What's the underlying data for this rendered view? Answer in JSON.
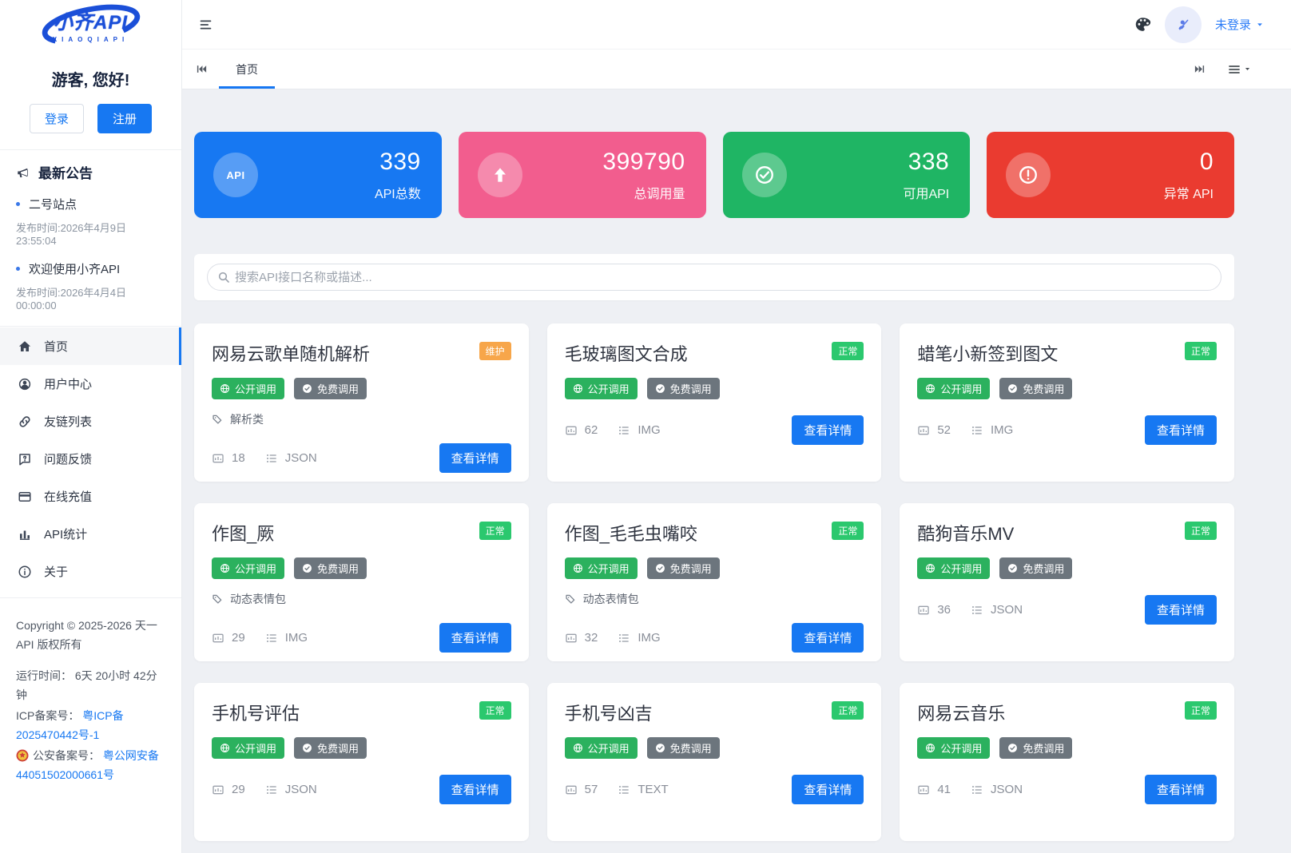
{
  "brand": {
    "name": "小齐API",
    "subtitle": "XIAOQIAPI"
  },
  "header": {
    "login_status": "未登录"
  },
  "tabs": {
    "active": "首页"
  },
  "sidebar": {
    "greeting": "游客, 您好!",
    "login_label": "登录",
    "register_label": "注册",
    "announcements_title": "最新公告",
    "announcements": [
      {
        "title": "二号站点",
        "time": "发布时间:2026年4月9日 23:55:04"
      },
      {
        "title": "欢迎使用小齐API",
        "time": "发布时间:2026年4月4日 00:00:00"
      }
    ],
    "menu": [
      {
        "label": "首页",
        "icon": "home-icon",
        "active": true
      },
      {
        "label": "用户中心",
        "icon": "user-icon"
      },
      {
        "label": "友链列表",
        "icon": "link-icon"
      },
      {
        "label": "问题反馈",
        "icon": "feedback-icon"
      },
      {
        "label": "在线充值",
        "icon": "recharge-icon"
      },
      {
        "label": "API统计",
        "icon": "bar-chart-icon"
      },
      {
        "label": "关于",
        "icon": "info-icon"
      }
    ],
    "footer": {
      "copyright": "Copyright © 2025-2026 天一 API 版权所有",
      "uptime": "运行时间： 6天 20小时 42分钟",
      "icp_label": "ICP备案号：",
      "icp_link": "粤ICP备 2025470442号-1",
      "police_label": "公安备案号：",
      "police_link": "粤公网安备 44051502000661号"
    }
  },
  "stats": [
    {
      "value": "339",
      "label": "API总数",
      "color": "#1778f2",
      "icon": "api-icon",
      "icon_text": "API"
    },
    {
      "value": "399790",
      "label": "总调用量",
      "color": "#f25d8e",
      "icon": "arrow-up-icon"
    },
    {
      "value": "338",
      "label": "可用API",
      "color": "#1fb564",
      "icon": "check-circle-icon"
    },
    {
      "value": "0",
      "label": "异常 API",
      "color": "#ea3b30",
      "icon": "alert-circle-icon"
    }
  ],
  "search": {
    "placeholder": "搜索API接口名称或描述..."
  },
  "badge_labels": {
    "public": "公开调用",
    "free": "免费调用"
  },
  "labels": {
    "detail_button": "查看详情"
  },
  "colors": {
    "accent_blue": "#1778f2",
    "status_normal": "#2bc86e",
    "status_maintenance": "#f7a64a",
    "badge_public": "#2bb15e",
    "badge_free": "#6c757d"
  },
  "api_cards": [
    {
      "title": "网易云歌单随机解析",
      "status": "维护",
      "status_type": "maintenance",
      "tag": "解析类",
      "calls": "18",
      "format": "JSON"
    },
    {
      "title": "毛玻璃图文合成",
      "status": "正常",
      "status_type": "normal",
      "tag": null,
      "calls": "62",
      "format": "IMG"
    },
    {
      "title": "蜡笔小新签到图文",
      "status": "正常",
      "status_type": "normal",
      "tag": null,
      "calls": "52",
      "format": "IMG"
    },
    {
      "title": "作图_厥",
      "status": "正常",
      "status_type": "normal",
      "tag": "动态表情包",
      "calls": "29",
      "format": "IMG"
    },
    {
      "title": "作图_毛毛虫嘴咬",
      "status": "正常",
      "status_type": "normal",
      "tag": "动态表情包",
      "calls": "32",
      "format": "IMG"
    },
    {
      "title": "酷狗音乐MV",
      "status": "正常",
      "status_type": "normal",
      "tag": null,
      "calls": "36",
      "format": "JSON"
    },
    {
      "title": "手机号评估",
      "status": "正常",
      "status_type": "normal",
      "tag": null,
      "calls": "29",
      "format": "JSON"
    },
    {
      "title": "手机号凶吉",
      "status": "正常",
      "status_type": "normal",
      "tag": null,
      "calls": "57",
      "format": "TEXT"
    },
    {
      "title": "网易云音乐",
      "status": "正常",
      "status_type": "normal",
      "tag": null,
      "calls": "41",
      "format": "JSON"
    }
  ]
}
